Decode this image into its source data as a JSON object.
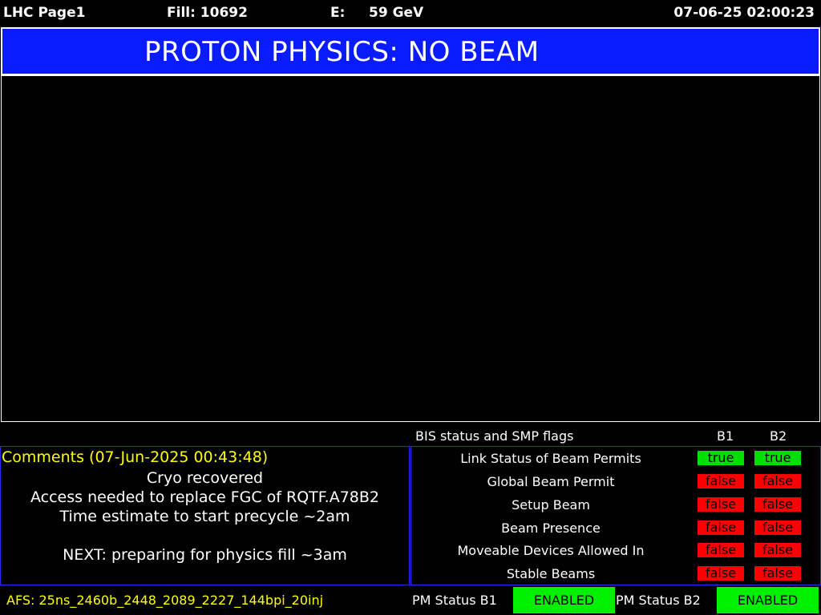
{
  "header": {
    "page_name": "LHC Page1",
    "fill": "Fill: 10692",
    "energy_label": "E:",
    "energy_value": "59 GeV",
    "datetime": "07-06-25 02:00:23"
  },
  "banner": {
    "text": "PROTON PHYSICS: NO BEAM",
    "color": "#0a1cff"
  },
  "bis": {
    "title": "BIS status and SMP flags",
    "col_b1": "B1",
    "col_b2": "B2",
    "flags": [
      {
        "label": "Link Status of Beam Permits",
        "b1": "true",
        "b2": "true"
      },
      {
        "label": "Global Beam Permit",
        "b1": "false",
        "b2": "false"
      },
      {
        "label": "Setup Beam",
        "b1": "false",
        "b2": "false"
      },
      {
        "label": "Beam Presence",
        "b1": "false",
        "b2": "false"
      },
      {
        "label": "Moveable Devices Allowed In",
        "b1": "false",
        "b2": "false"
      },
      {
        "label": "Stable Beams",
        "b1": "false",
        "b2": "false"
      }
    ],
    "true_color": "#00e000",
    "false_color": "#ff0000"
  },
  "comments": {
    "title": "Comments (07-Jun-2025 00:43:48)",
    "lines": [
      "Cryo recovered",
      "Access needed to replace FGC of RQTF.A78B2",
      "Time estimate to start precycle ~2am",
      "NEXT: preparing for physics fill ~3am"
    ]
  },
  "footer": {
    "afs": "AFS: 25ns_2460b_2448_2089_2227_144bpi_20inj",
    "pm_b1_label": "PM Status B1",
    "pm_b1_value": "ENABLED",
    "pm_b2_label": "PM Status B2",
    "pm_b2_value": "ENABLED",
    "enabled_color": "#00f000"
  }
}
